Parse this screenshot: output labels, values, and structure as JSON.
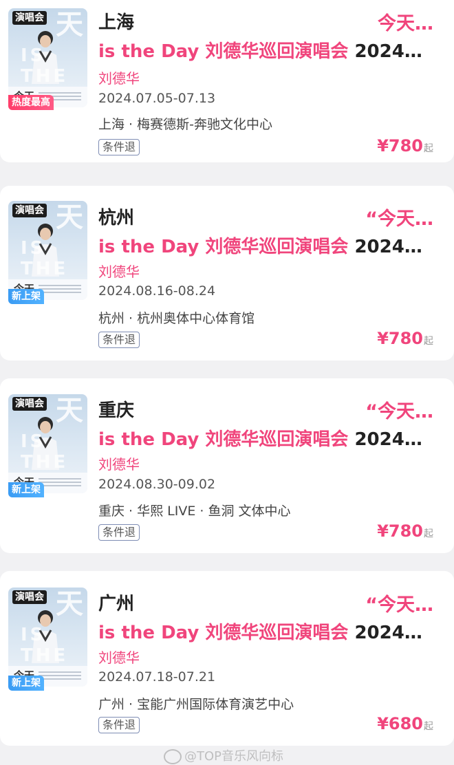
{
  "cards": [
    {
      "poster_tag": "演唱会",
      "ribbon": "热度最高",
      "ribbon_type": "hot",
      "city": "上海",
      "quote": "今天…",
      "title_main": "is the Day 刘德华巡回演唱会 ",
      "title_tail": "2024…",
      "artist": "刘德华",
      "dates": "2024.07.05-07.13",
      "venue": "上海 · 梅赛德斯-奔驰文化中心",
      "tag": "条件退",
      "price": "¥780",
      "price_suffix": "起"
    },
    {
      "poster_tag": "演唱会",
      "ribbon": "新上架",
      "ribbon_type": "new",
      "city": "杭州",
      "quote": "“今天…",
      "title_main": "is the Day 刘德华巡回演唱会 ",
      "title_tail": "2024…",
      "artist": "刘德华",
      "dates": "2024.08.16-08.24",
      "venue": "杭州 · 杭州奥体中心体育馆",
      "tag": "条件退",
      "price": "¥780",
      "price_suffix": "起"
    },
    {
      "poster_tag": "演唱会",
      "ribbon": "新上架",
      "ribbon_type": "new",
      "city": "重庆",
      "quote": "“今天…",
      "title_main": "is the Day 刘德华巡回演唱会 ",
      "title_tail": "2024…",
      "artist": "刘德华",
      "dates": "2024.08.30-09.02",
      "venue": "重庆 · 华熙 LIVE · 鱼洞 文体中心",
      "tag": "条件退",
      "price": "¥780",
      "price_suffix": "起"
    },
    {
      "poster_tag": "演唱会",
      "ribbon": "新上架",
      "ribbon_type": "new",
      "city": "广州",
      "quote": "“今天…",
      "title_main": "is the Day 刘德华巡回演唱会 ",
      "title_tail": "2024…",
      "artist": "刘德华",
      "dates": "2024.07.18-07.21",
      "venue": "广州 · 宝能广州国际体育演艺中心",
      "tag": "条件退",
      "price": "¥680",
      "price_suffix": "起"
    }
  ],
  "poster": {
    "art_text": "天",
    "isthe_text": "IS THE",
    "bottom_text": "今天"
  },
  "watermark": "@TOP音乐风向标",
  "colors": {
    "accent": "#f0457c",
    "hot_ribbon": "#ff3d6a",
    "new_ribbon": "#3a9bf3",
    "tag_border": "#7d8cb3"
  }
}
